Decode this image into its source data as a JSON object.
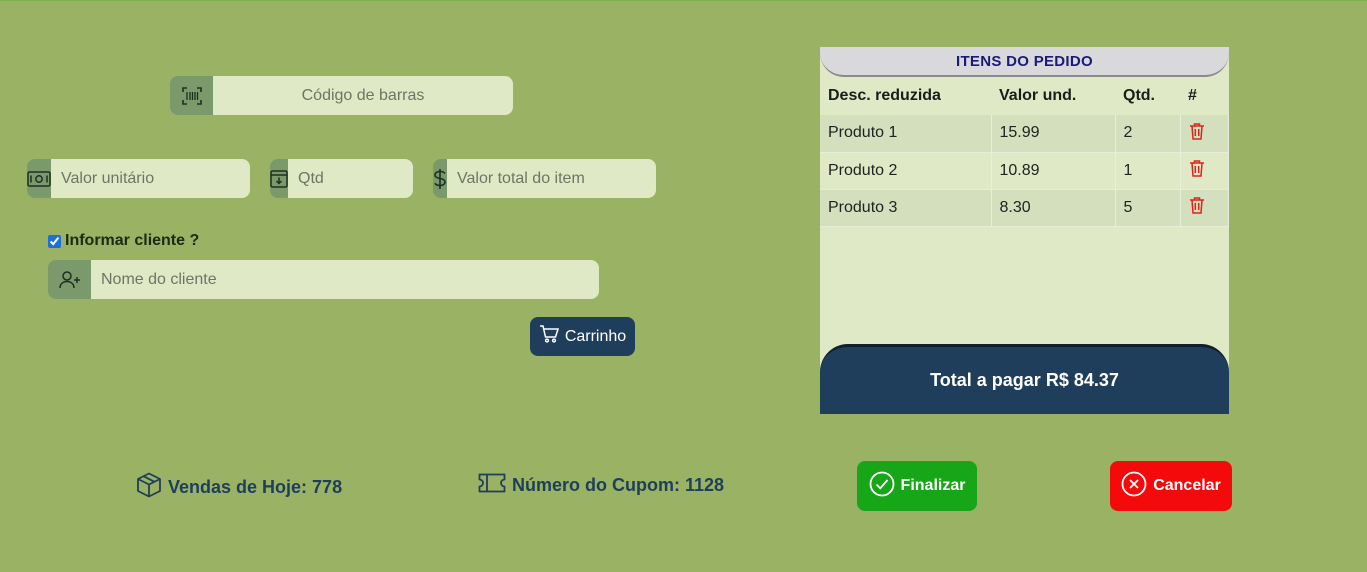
{
  "form": {
    "barcode_placeholder": "Código de barras",
    "unit_value_placeholder": "Valor unitário",
    "qty_placeholder": "Qtd",
    "total_item_placeholder": "Valor total do item",
    "client_checkbox_label": "Informar cliente ?",
    "client_checkbox_checked": true,
    "client_name_placeholder": "Nome do cliente",
    "cart_button_label": "Carrinho"
  },
  "order": {
    "title": "ITENS DO PEDIDO",
    "columns": [
      "Desc. reduzida",
      "Valor und.",
      "Qtd.",
      "#"
    ],
    "rows": [
      {
        "desc": "Produto 1",
        "value": "15.99",
        "qty": "2"
      },
      {
        "desc": "Produto 2",
        "value": "10.89",
        "qty": "1"
      },
      {
        "desc": "Produto 3",
        "value": "8.30",
        "qty": "5"
      }
    ],
    "total_label": "Total a pagar R$ 84.37"
  },
  "footer": {
    "sales_today": "Vendas de Hoje: 778",
    "coupon_number": "Número do Cupom: 1128",
    "finalize_label": "Finalizar",
    "cancel_label": "Cancelar"
  },
  "colors": {
    "background": "#99b264",
    "navy": "#1f3e5c",
    "finalize": "#17a617",
    "cancel": "#f40a0a",
    "trash": "#e0221c"
  }
}
